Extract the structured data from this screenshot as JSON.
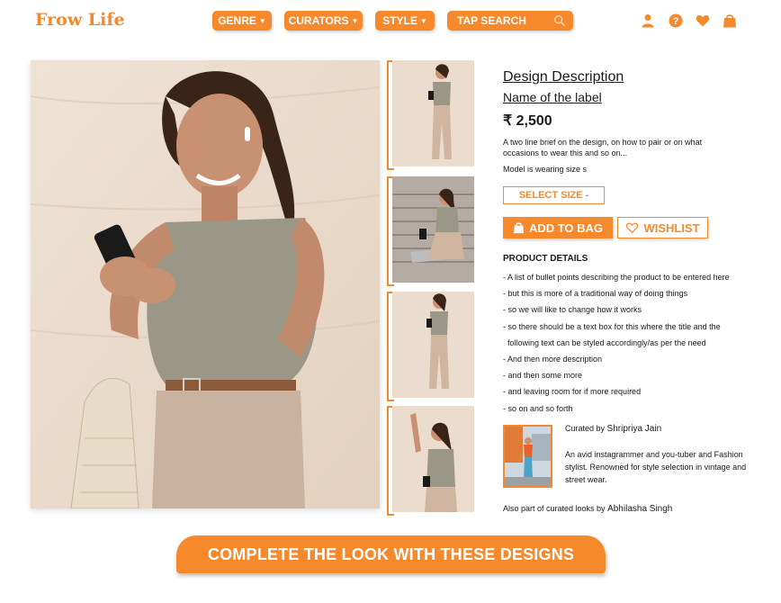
{
  "brand": {
    "logo": "Frow Life",
    "accent": "#f5892b"
  },
  "nav": {
    "items": [
      {
        "label": "GENRE"
      },
      {
        "label": "CURATORS"
      },
      {
        "label": "STYLE"
      }
    ],
    "search_placeholder": "TAP SEARCH"
  },
  "header_icons": [
    "user-icon",
    "help-icon",
    "heart-icon",
    "shopping-bag-icon"
  ],
  "product": {
    "title": "Design Description",
    "label": "Name of the label",
    "price": "₹ 2,500",
    "brief": "A two line brief on the design, on how to pair or on what occasions to  wear this and so on...",
    "size_note": "Model is wearing size s",
    "select_size": "SELECT SIZE -",
    "add_to_bag": "ADD TO BAG",
    "wishlist": "WISHLIST",
    "details_title": "PRODUCT DETAILS",
    "details": [
      "- A list of bullet points describing the product to be entered here",
      "- but this is more of a traditional way of doing things",
      "- so we will like to change how it works",
      "- so there should be a text box for this where the title and the",
      "  following text can be styled accordingly/as per the need",
      "- And then more description",
      "- and then some more",
      "- and leaving room for if more required",
      "- so on and so forth"
    ]
  },
  "curator": {
    "prefix": "Curated by",
    "name": "Shripriya Jain",
    "bio": "An avid instagrammer and you-tuber and Fashion stylist.  Renowned for style selection in vintage and street wear.",
    "also_prefix": "Also part of curated looks by",
    "also_name": "Abhilasha Singh"
  },
  "cta": "COMPLETE THE LOOK WITH THESE DESIGNS"
}
